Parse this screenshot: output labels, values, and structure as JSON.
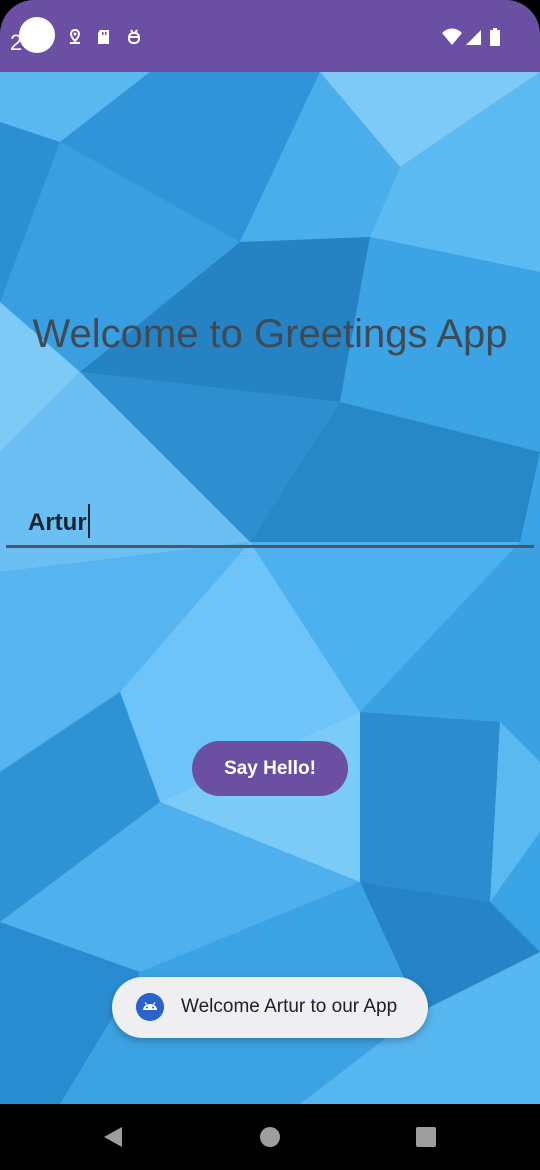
{
  "status_bar": {
    "time": "2",
    "icons": [
      "location-icon",
      "sd-card-icon",
      "debug-icon",
      "wifi-icon",
      "signal-icon",
      "battery-icon"
    ]
  },
  "main": {
    "title": "Welcome to Greetings App",
    "name_input": {
      "value": "Artur"
    },
    "say_hello_label": "Say Hello!"
  },
  "toast": {
    "icon": "android-icon",
    "message": "Welcome Artur to our App"
  },
  "nav_bar": {
    "buttons": [
      "back-icon",
      "home-icon",
      "recents-icon"
    ]
  },
  "colors": {
    "accent": "#6a4fa3",
    "background": "#3aa5e6",
    "title_text": "#3f4a57"
  }
}
